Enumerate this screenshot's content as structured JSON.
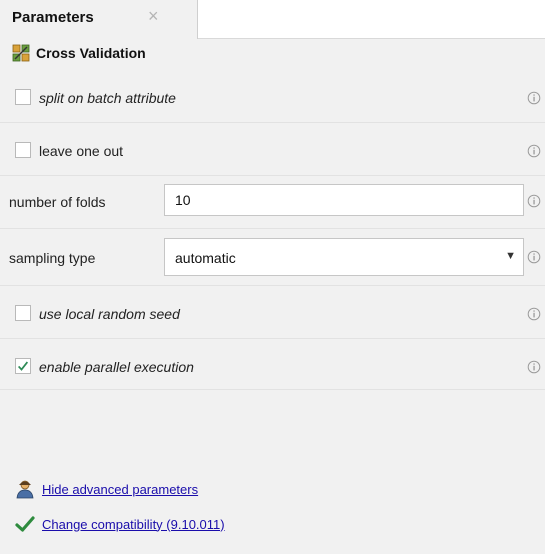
{
  "tab": {
    "title": "Parameters",
    "close_glyph": "×"
  },
  "operator": {
    "title": "Cross Validation",
    "icon": "cross-validation-icon"
  },
  "parameters": {
    "split_on_batch": {
      "label": "split on batch attribute",
      "checked": false
    },
    "leave_one_out": {
      "label": "leave one out",
      "checked": false
    },
    "number_of_folds": {
      "label": "number of folds",
      "value": "10"
    },
    "sampling_type": {
      "label": "sampling type",
      "value": "automatic"
    },
    "use_local_random_seed": {
      "label": "use local random seed",
      "checked": false
    },
    "enable_parallel_execution": {
      "label": "enable parallel execution",
      "checked": true
    }
  },
  "footer": {
    "hide_advanced": "Hide advanced parameters",
    "change_compatibility": "Change compatibility (9.10.011)"
  },
  "colors": {
    "link": "#1a0dab",
    "check": "#2e8b57",
    "background": "#f1f1f1"
  }
}
